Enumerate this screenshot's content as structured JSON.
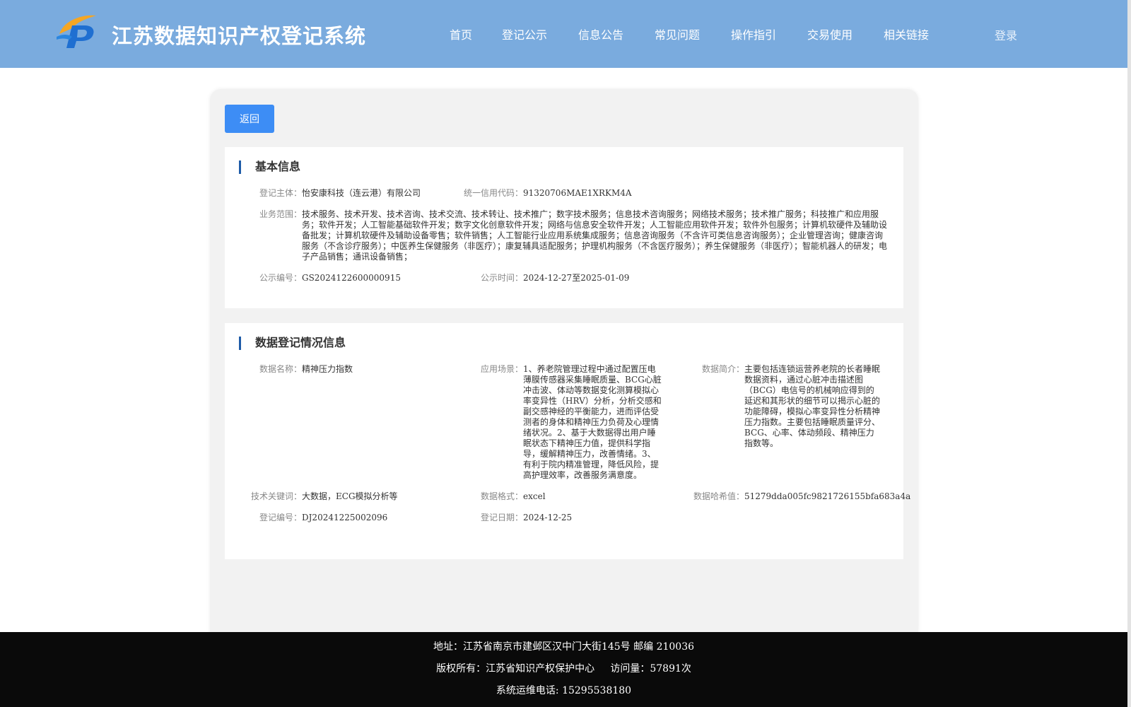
{
  "header": {
    "title": "江苏数据知识产权登记系统",
    "logo_icon": "ip-logo-icon",
    "nav": [
      "首页",
      "登记公示",
      "信息公告",
      "常见问题",
      "操作指引",
      "交易使用",
      "相关链接"
    ],
    "login_label": "登录"
  },
  "back_label": "返回",
  "basic": {
    "title": "基本信息",
    "entity_label": "登记主体：",
    "entity_value": "怡安康科技（连云港）有限公司",
    "credit_label": "统一信用代码：",
    "credit_value": "91320706MAE1XRKM4A",
    "scope_label": "业务范围：",
    "scope_value": "技术服务、技术开发、技术咨询、技术交流、技术转让、技术推广；数字技术服务；信息技术咨询服务；网络技术服务；技术推广服务；科技推广和应用服务；软件开发；人工智能基础软件开发；数字文化创意软件开发；网络与信息安全软件开发；人工智能应用软件开发；软件外包服务；计算机软硬件及辅助设备批发；计算机软硬件及辅助设备零售；软件销售；人工智能行业应用系统集成服务；信息咨询服务（不含许可类信息咨询服务）；企业管理咨询；健康咨询服务（不含诊疗服务）；中医养生保健服务（非医疗）；康复辅具适配服务；护理机构服务（不含医疗服务）；养生保健服务（非医疗）；智能机器人的研发；电子产品销售；通讯设备销售；",
    "pub_no_label": "公示编号：",
    "pub_no_value": "GS2024122600000915",
    "pub_time_label": "公示时间：",
    "pub_time_value": "2024-12-27至2025-01-09"
  },
  "data_reg": {
    "title": "数据登记情况信息",
    "name_label": "数据名称：",
    "name_value": "精神压力指数",
    "scene_label": "应用场景：",
    "scene_value": "1、养老院管理过程中通过配置压电薄膜传感器采集睡眠质量、BCG心脏冲击波、体动等数据变化测算模拟心率变异性（HRV）分析，分析交感和副交感神经的平衡能力，进而评估受测者的身体和精神压力负荷及心理情绪状况。2、基于大数据得出用户睡眠状态下精神压力值，提供科学指导，缓解精神压力，改善情绪。3、有利于院内精准管理，降低风险，提高护理效率，改善服务满意度。",
    "intro_label": "数据简介：",
    "intro_value": "主要包括连锁运营养老院的长者睡眠数据资料，通过心脏冲击描述图（BCG）电信号的机械响应得到的延迟和其形状的细节可以揭示心脏的功能障碍，模拟心率变异性分析精神压力指数。主要包括睡眠质量评分、BCG、心率、体动频段、精神压力指数等。",
    "keyword_label": "技术关键词：",
    "keyword_value": "大数据，ECG模拟分析等",
    "format_label": "数据格式：",
    "format_value": "excel",
    "hash_label": "数据哈希值：",
    "hash_value": "51279dda005fc9821726155bfa683a4a",
    "reg_no_label": "登记编号：",
    "reg_no_value": "DJ20241225002096",
    "reg_date_label": "登记日期：",
    "reg_date_value": "2024-12-25"
  },
  "footer": {
    "address": "地址：江苏省南京市建邺区汉中门大街145号 邮编 210036",
    "copyright": "版权所有：江苏省知识产权保护中心     访问量：57891次",
    "phone": "系统运维电话: 15295538180"
  }
}
